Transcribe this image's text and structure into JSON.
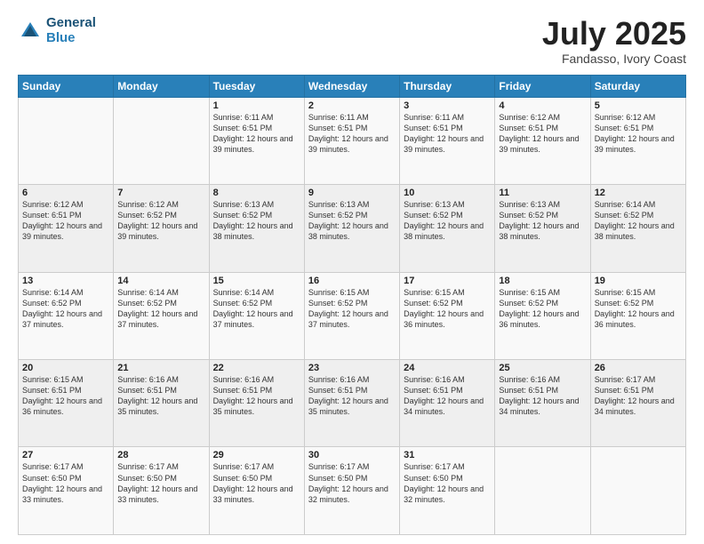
{
  "logo": {
    "line1": "General",
    "line2": "Blue"
  },
  "title": "July 2025",
  "subtitle": "Fandasso, Ivory Coast",
  "days_of_week": [
    "Sunday",
    "Monday",
    "Tuesday",
    "Wednesday",
    "Thursday",
    "Friday",
    "Saturday"
  ],
  "weeks": [
    [
      {
        "day": "",
        "info": ""
      },
      {
        "day": "",
        "info": ""
      },
      {
        "day": "1",
        "info": "Sunrise: 6:11 AM\nSunset: 6:51 PM\nDaylight: 12 hours and 39 minutes."
      },
      {
        "day": "2",
        "info": "Sunrise: 6:11 AM\nSunset: 6:51 PM\nDaylight: 12 hours and 39 minutes."
      },
      {
        "day": "3",
        "info": "Sunrise: 6:11 AM\nSunset: 6:51 PM\nDaylight: 12 hours and 39 minutes."
      },
      {
        "day": "4",
        "info": "Sunrise: 6:12 AM\nSunset: 6:51 PM\nDaylight: 12 hours and 39 minutes."
      },
      {
        "day": "5",
        "info": "Sunrise: 6:12 AM\nSunset: 6:51 PM\nDaylight: 12 hours and 39 minutes."
      }
    ],
    [
      {
        "day": "6",
        "info": "Sunrise: 6:12 AM\nSunset: 6:51 PM\nDaylight: 12 hours and 39 minutes."
      },
      {
        "day": "7",
        "info": "Sunrise: 6:12 AM\nSunset: 6:52 PM\nDaylight: 12 hours and 39 minutes."
      },
      {
        "day": "8",
        "info": "Sunrise: 6:13 AM\nSunset: 6:52 PM\nDaylight: 12 hours and 38 minutes."
      },
      {
        "day": "9",
        "info": "Sunrise: 6:13 AM\nSunset: 6:52 PM\nDaylight: 12 hours and 38 minutes."
      },
      {
        "day": "10",
        "info": "Sunrise: 6:13 AM\nSunset: 6:52 PM\nDaylight: 12 hours and 38 minutes."
      },
      {
        "day": "11",
        "info": "Sunrise: 6:13 AM\nSunset: 6:52 PM\nDaylight: 12 hours and 38 minutes."
      },
      {
        "day": "12",
        "info": "Sunrise: 6:14 AM\nSunset: 6:52 PM\nDaylight: 12 hours and 38 minutes."
      }
    ],
    [
      {
        "day": "13",
        "info": "Sunrise: 6:14 AM\nSunset: 6:52 PM\nDaylight: 12 hours and 37 minutes."
      },
      {
        "day": "14",
        "info": "Sunrise: 6:14 AM\nSunset: 6:52 PM\nDaylight: 12 hours and 37 minutes."
      },
      {
        "day": "15",
        "info": "Sunrise: 6:14 AM\nSunset: 6:52 PM\nDaylight: 12 hours and 37 minutes."
      },
      {
        "day": "16",
        "info": "Sunrise: 6:15 AM\nSunset: 6:52 PM\nDaylight: 12 hours and 37 minutes."
      },
      {
        "day": "17",
        "info": "Sunrise: 6:15 AM\nSunset: 6:52 PM\nDaylight: 12 hours and 36 minutes."
      },
      {
        "day": "18",
        "info": "Sunrise: 6:15 AM\nSunset: 6:52 PM\nDaylight: 12 hours and 36 minutes."
      },
      {
        "day": "19",
        "info": "Sunrise: 6:15 AM\nSunset: 6:52 PM\nDaylight: 12 hours and 36 minutes."
      }
    ],
    [
      {
        "day": "20",
        "info": "Sunrise: 6:15 AM\nSunset: 6:51 PM\nDaylight: 12 hours and 36 minutes."
      },
      {
        "day": "21",
        "info": "Sunrise: 6:16 AM\nSunset: 6:51 PM\nDaylight: 12 hours and 35 minutes."
      },
      {
        "day": "22",
        "info": "Sunrise: 6:16 AM\nSunset: 6:51 PM\nDaylight: 12 hours and 35 minutes."
      },
      {
        "day": "23",
        "info": "Sunrise: 6:16 AM\nSunset: 6:51 PM\nDaylight: 12 hours and 35 minutes."
      },
      {
        "day": "24",
        "info": "Sunrise: 6:16 AM\nSunset: 6:51 PM\nDaylight: 12 hours and 34 minutes."
      },
      {
        "day": "25",
        "info": "Sunrise: 6:16 AM\nSunset: 6:51 PM\nDaylight: 12 hours and 34 minutes."
      },
      {
        "day": "26",
        "info": "Sunrise: 6:17 AM\nSunset: 6:51 PM\nDaylight: 12 hours and 34 minutes."
      }
    ],
    [
      {
        "day": "27",
        "info": "Sunrise: 6:17 AM\nSunset: 6:50 PM\nDaylight: 12 hours and 33 minutes."
      },
      {
        "day": "28",
        "info": "Sunrise: 6:17 AM\nSunset: 6:50 PM\nDaylight: 12 hours and 33 minutes."
      },
      {
        "day": "29",
        "info": "Sunrise: 6:17 AM\nSunset: 6:50 PM\nDaylight: 12 hours and 33 minutes."
      },
      {
        "day": "30",
        "info": "Sunrise: 6:17 AM\nSunset: 6:50 PM\nDaylight: 12 hours and 32 minutes."
      },
      {
        "day": "31",
        "info": "Sunrise: 6:17 AM\nSunset: 6:50 PM\nDaylight: 12 hours and 32 minutes."
      },
      {
        "day": "",
        "info": ""
      },
      {
        "day": "",
        "info": ""
      }
    ]
  ]
}
